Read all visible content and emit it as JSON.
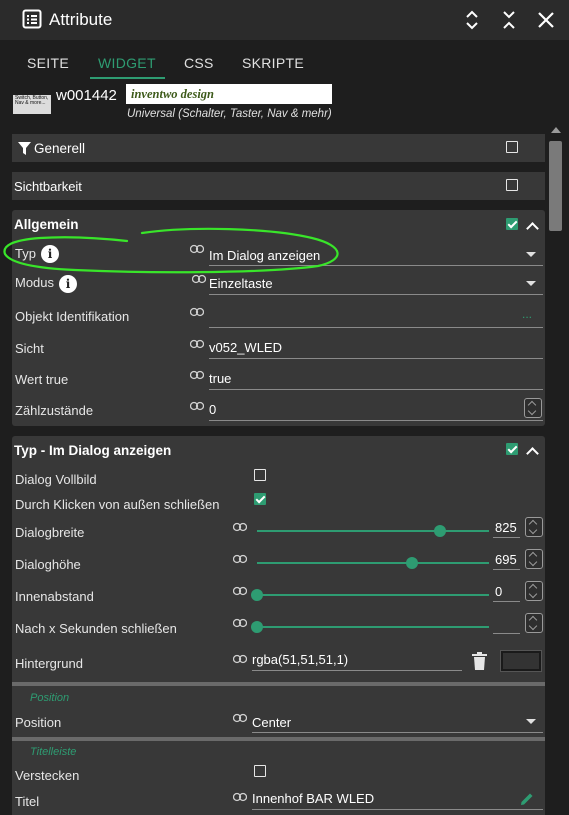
{
  "window": {
    "title": "Attribute"
  },
  "tabs": [
    {
      "label": "SEITE"
    },
    {
      "label": "WIDGET"
    },
    {
      "label": "CSS"
    },
    {
      "label": "SKRIPTE"
    }
  ],
  "widget": {
    "thumb_text": "Switch, Button, Nav & more...",
    "id": "w001442",
    "name": "inventwo design",
    "description": "Universal (Schalter, Taster, Nav & mehr)"
  },
  "sections": {
    "generell": {
      "title": "Generell",
      "checked": false
    },
    "sichtbarkeit": {
      "title": "Sichtbarkeit",
      "checked": false
    },
    "allgemein": {
      "title": "Allgemein",
      "checked": true,
      "rows": {
        "typ": {
          "label": "Typ",
          "value": "Im Dialog anzeigen"
        },
        "modus": {
          "label": "Modus",
          "value": "Einzeltaste"
        },
        "objekt": {
          "label": "Objekt Identifikation",
          "value": "",
          "more": "..."
        },
        "sicht": {
          "label": "Sicht",
          "value": "v052_WLED"
        },
        "wert_true": {
          "label": "Wert true",
          "value": "true"
        },
        "zaehl": {
          "label": "Zählzustände",
          "value": "0"
        }
      }
    },
    "dialog": {
      "title": "Typ - Im Dialog anzeigen",
      "checked": true,
      "rows": {
        "vollbild": {
          "label": "Dialog Vollbild",
          "checked": false
        },
        "klicken": {
          "label": "Durch Klicken von außen schließen",
          "checked": true
        },
        "breite": {
          "label": "Dialogbreite",
          "value": "825",
          "level": 0.79
        },
        "hoehe": {
          "label": "Dialoghöhe",
          "value": "695",
          "level": 0.67
        },
        "innenabstand": {
          "label": "Innenabstand",
          "value": "0",
          "level": 0
        },
        "sekunden": {
          "label": "Nach x Sekunden schließen",
          "value": "",
          "level": 0
        },
        "hintergrund": {
          "label": "Hintergrund",
          "value": "rgba(51,51,51,1)"
        }
      },
      "position_head": "Position",
      "position": {
        "label": "Position",
        "value": "Center"
      },
      "titelleiste_head": "Titelleiste",
      "verstecken": {
        "label": "Verstecken",
        "checked": false
      },
      "titel": {
        "label": "Titel",
        "value": "Innenhof BAR WLED"
      }
    }
  },
  "colors": {
    "accent": "#2e9c72",
    "panel": "#383838",
    "background": "#1e1e1e",
    "annotation": "#39e52a"
  }
}
